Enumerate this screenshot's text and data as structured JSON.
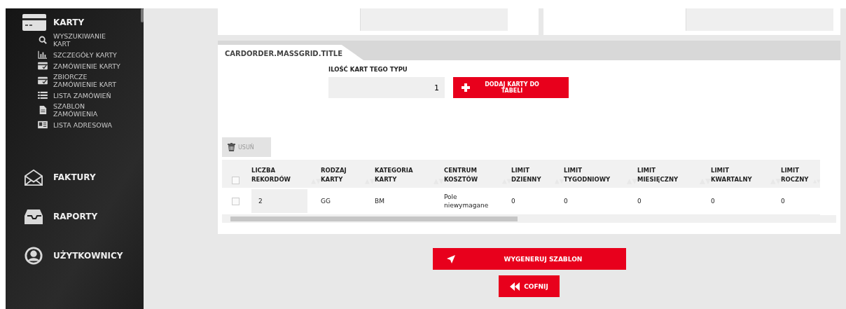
{
  "sidebar": {
    "section": {
      "label": "KARTY",
      "items": [
        {
          "label": "WYSZUKIWANIE KART"
        },
        {
          "label": "SZCZEGÓŁY KARTY"
        },
        {
          "label": "ZAMÓWIENIE KARTY"
        },
        {
          "label": "ZBIORCZE ZAMÓWIENIE KART"
        },
        {
          "label": "LISTA ZAMÓWIEŃ"
        },
        {
          "label": "SZABLON ZAMÓWIENIA"
        },
        {
          "label": "LISTA ADRESOWA"
        }
      ]
    },
    "main_items": [
      {
        "label": "FAKTURY"
      },
      {
        "label": "RAPORTY"
      },
      {
        "label": "UŻYTKOWNICY"
      }
    ]
  },
  "panel": {
    "tab": "CARDORDER.MASSGRID.TITLE",
    "quantity_label": "ILOŚĆ KART TEGO TYPU",
    "quantity_value": "1",
    "add_button": "DODAJ KARTY DO TABELI",
    "delete_button": "USUŃ",
    "table": {
      "select_all_checked": false,
      "columns": [
        "LICZBA REKORDÓW",
        "RODZAJ KARTY",
        "KATEGORIA KARTY",
        "CENTRUM KOSZTÓW",
        "LIMIT DZIENNY",
        "LIMIT TYGODNIOWY",
        "LIMIT MIESIĘCZNY",
        "LIMIT KWARTALNY",
        "LIMIT ROCZNY"
      ],
      "rows": [
        {
          "checked": false,
          "cells": [
            "2",
            "GG",
            "BM",
            "Pole niewymagane",
            "0",
            "0",
            "0",
            "0",
            "0"
          ]
        }
      ]
    }
  },
  "generate_button": "WYGENERUJ SZABLON",
  "back_button": "COFNIJ"
}
